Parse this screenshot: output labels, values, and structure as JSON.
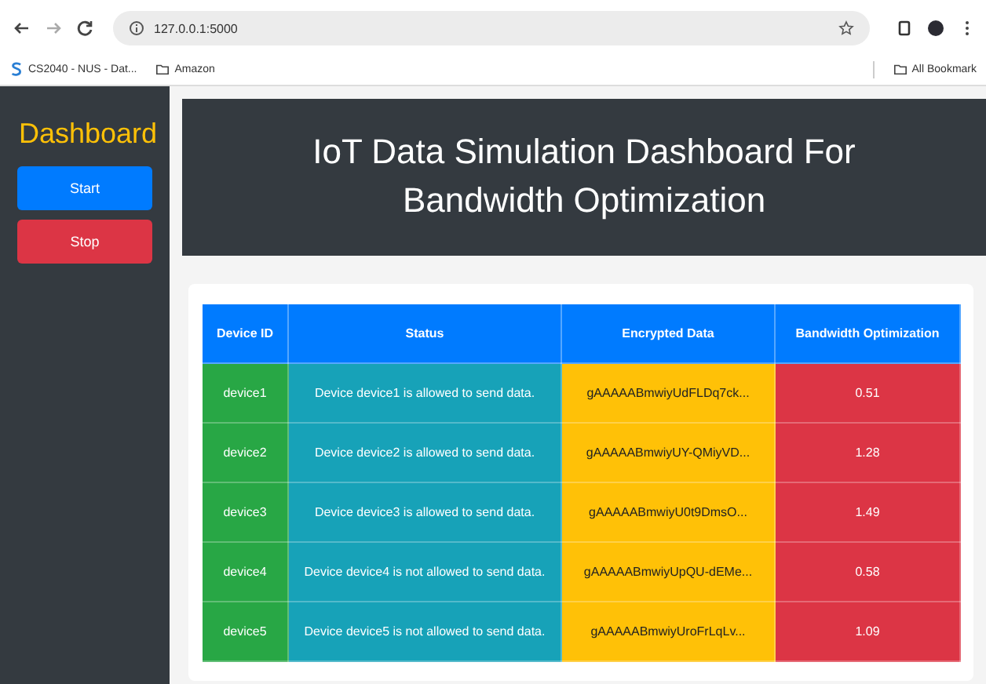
{
  "browser": {
    "url": "127.0.0.1:5000",
    "bookmarks": [
      {
        "kind": "site",
        "label": "CS2040 - NUS - Dat..."
      },
      {
        "kind": "folder",
        "label": "Amazon"
      }
    ],
    "all_bookmarks": "All Bookmark"
  },
  "sidebar": {
    "title": "Dashboard",
    "buttons": [
      {
        "label": "Start",
        "kind": "primary"
      },
      {
        "label": "Stop",
        "kind": "danger"
      }
    ]
  },
  "header": {
    "title": "IoT Data Simulation Dashboard For Bandwidth Optimization"
  },
  "table": {
    "columns": [
      "Device ID",
      "Status",
      "Encrypted Data",
      "Bandwidth Optimization"
    ],
    "rows": [
      [
        "device1",
        "Device device1 is allowed to send data.",
        "gAAAAABmwiyUdFLDq7ck...",
        "0.51"
      ],
      [
        "device2",
        "Device device2 is allowed to send data.",
        "gAAAAABmwiyUY-QMiyVD...",
        "1.28"
      ],
      [
        "device3",
        "Device device3 is allowed to send data.",
        "gAAAAABmwiyU0t9DmsO...",
        "1.49"
      ],
      [
        "device4",
        "Device device4 is not allowed to send data.",
        "gAAAAABmwiyUpQU-dEMe...",
        "0.58"
      ],
      [
        "device5",
        "Device device5 is not allowed to send data.",
        "gAAAAABmwiyUroFrLqLv...",
        "1.09"
      ]
    ]
  }
}
